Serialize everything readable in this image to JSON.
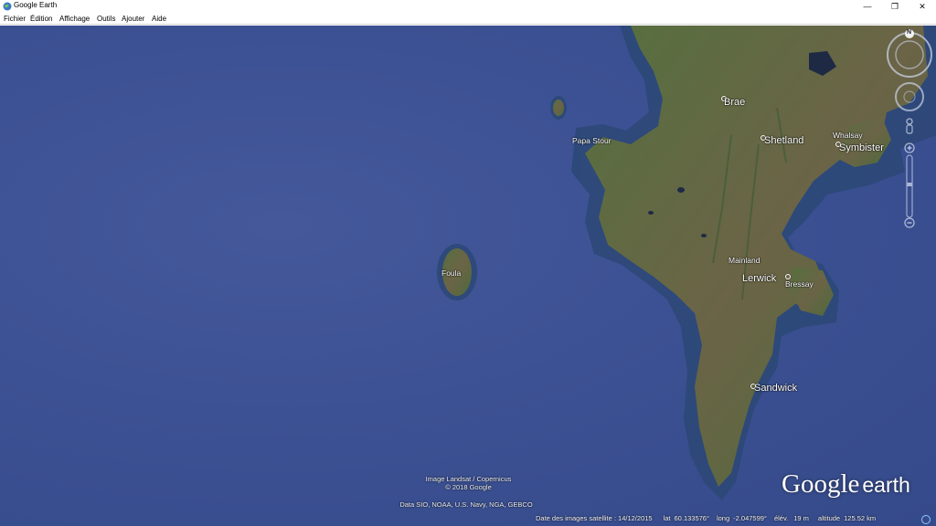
{
  "window": {
    "title": "Google Earth",
    "minimize_glyph": "—",
    "maximize_glyph": "❐",
    "close_glyph": "✕"
  },
  "menu": [
    "Fichier",
    "Édition",
    "Affichage",
    "Outils",
    "Ajouter",
    "Aide"
  ],
  "places": [
    {
      "name": "Brae",
      "size": "lg"
    },
    {
      "name": "Shetland",
      "size": "lg"
    },
    {
      "name": "Whalsay",
      "size": "sm"
    },
    {
      "name": "Symbister",
      "size": "lg"
    },
    {
      "name": "Papa Stour",
      "size": "sm"
    },
    {
      "name": "Foula",
      "size": "sm"
    },
    {
      "name": "Mainland",
      "size": "sm"
    },
    {
      "name": "Lerwick",
      "size": "lg"
    },
    {
      "name": "Bressay",
      "size": "sm"
    },
    {
      "name": "Sandwick",
      "size": "lg"
    }
  ],
  "nav": {
    "compass_letter": "N"
  },
  "attribution": {
    "imagery_line1": "Image Landsat / Copernicus",
    "imagery_line2": "© 2018 Google",
    "data_line": "Data SIO, NOAA, U.S. Navy, NGA, GEBCO"
  },
  "logo": {
    "brand": "Google",
    "product": "earth"
  },
  "status": {
    "imagery_date": "Date des images satellite : 14/12/2015",
    "lat_label": "lat",
    "lat_value": "60.133576°",
    "long_label": "long",
    "long_value": "-2.047599°",
    "elev_label": "élév.",
    "elev_value": "19 m",
    "altitude_label": "altitude",
    "altitude_value": "125.52 km"
  },
  "colors": {
    "ocean": "#3d5294",
    "shelf": "#2a4a78",
    "land": "#4d6a3e",
    "land_brown": "#6e6447"
  }
}
